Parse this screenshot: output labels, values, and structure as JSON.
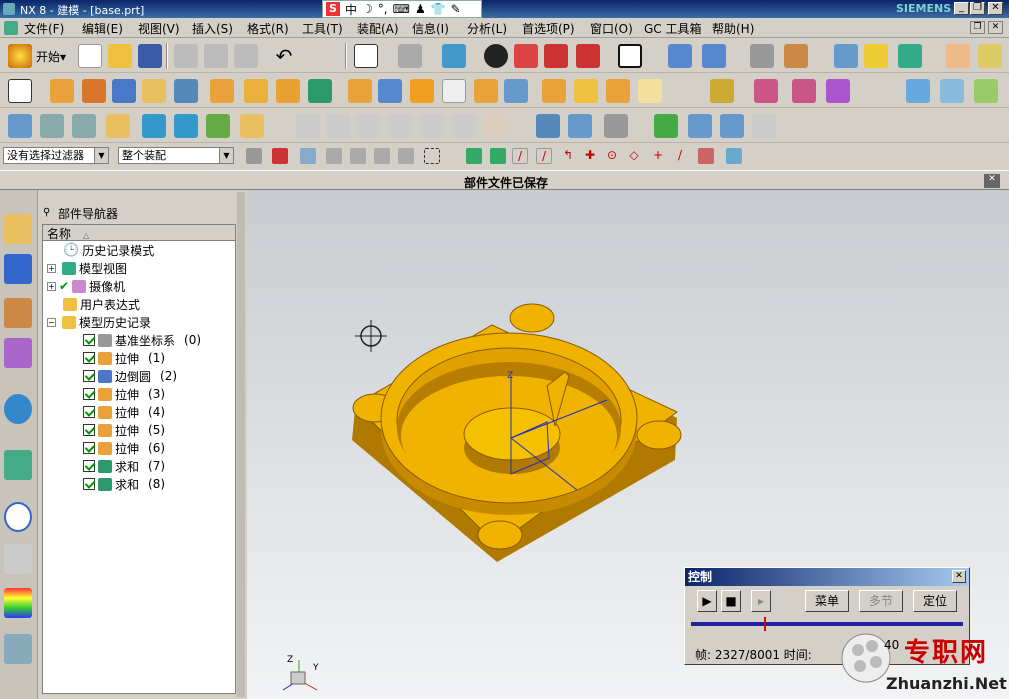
{
  "titlebar": {
    "title": "NX 8 - 建模 - [base.prt]",
    "brand": "SIEMENS",
    "min": "_",
    "restore": "❐",
    "close": "✕"
  },
  "ime": {
    "mode": "中"
  },
  "menu": [
    "文件(F)",
    "编辑(E)",
    "视图(V)",
    "插入(S)",
    "格式(R)",
    "工具(T)",
    "装配(A)",
    "信息(I)",
    "分析(L)",
    "首选项(P)",
    "窗口(O)",
    "GC 工具箱",
    "帮助(H)"
  ],
  "menu_right": {
    "restore": "❐",
    "close": "✕"
  },
  "toolbar": {
    "start": "开始▾"
  },
  "selection": {
    "filter": "没有选择过滤器",
    "scope": "整个装配"
  },
  "status": {
    "message": "部件文件已保存"
  },
  "navigator": {
    "title": "部件导航器",
    "column": "名称",
    "items": [
      {
        "label": "历史记录模式"
      },
      {
        "label": "模型视图"
      },
      {
        "label": "摄像机"
      },
      {
        "label": "用户表达式"
      },
      {
        "label": "模型历史记录"
      },
      {
        "label": "基准坐标系",
        "n": "(0)"
      },
      {
        "label": "拉伸",
        "n": "(1)"
      },
      {
        "label": "边倒圆",
        "n": "(2)"
      },
      {
        "label": "拉伸",
        "n": "(3)"
      },
      {
        "label": "拉伸",
        "n": "(4)"
      },
      {
        "label": "拉伸",
        "n": "(5)"
      },
      {
        "label": "拉伸",
        "n": "(6)"
      },
      {
        "label": "求和",
        "n": "(7)"
      },
      {
        "label": "求和",
        "n": "(8)"
      }
    ]
  },
  "control": {
    "title": "控制",
    "menu": "菜单",
    "multi": "多节",
    "position": "定位",
    "frame": "帧: 2327/8001 时间:",
    "time_tail": "40"
  },
  "watermark": {
    "text": "专职网",
    "url": "Zhuanzhi.Net"
  },
  "colors": {
    "part": "#f0b400",
    "axis": "#2030c0"
  }
}
